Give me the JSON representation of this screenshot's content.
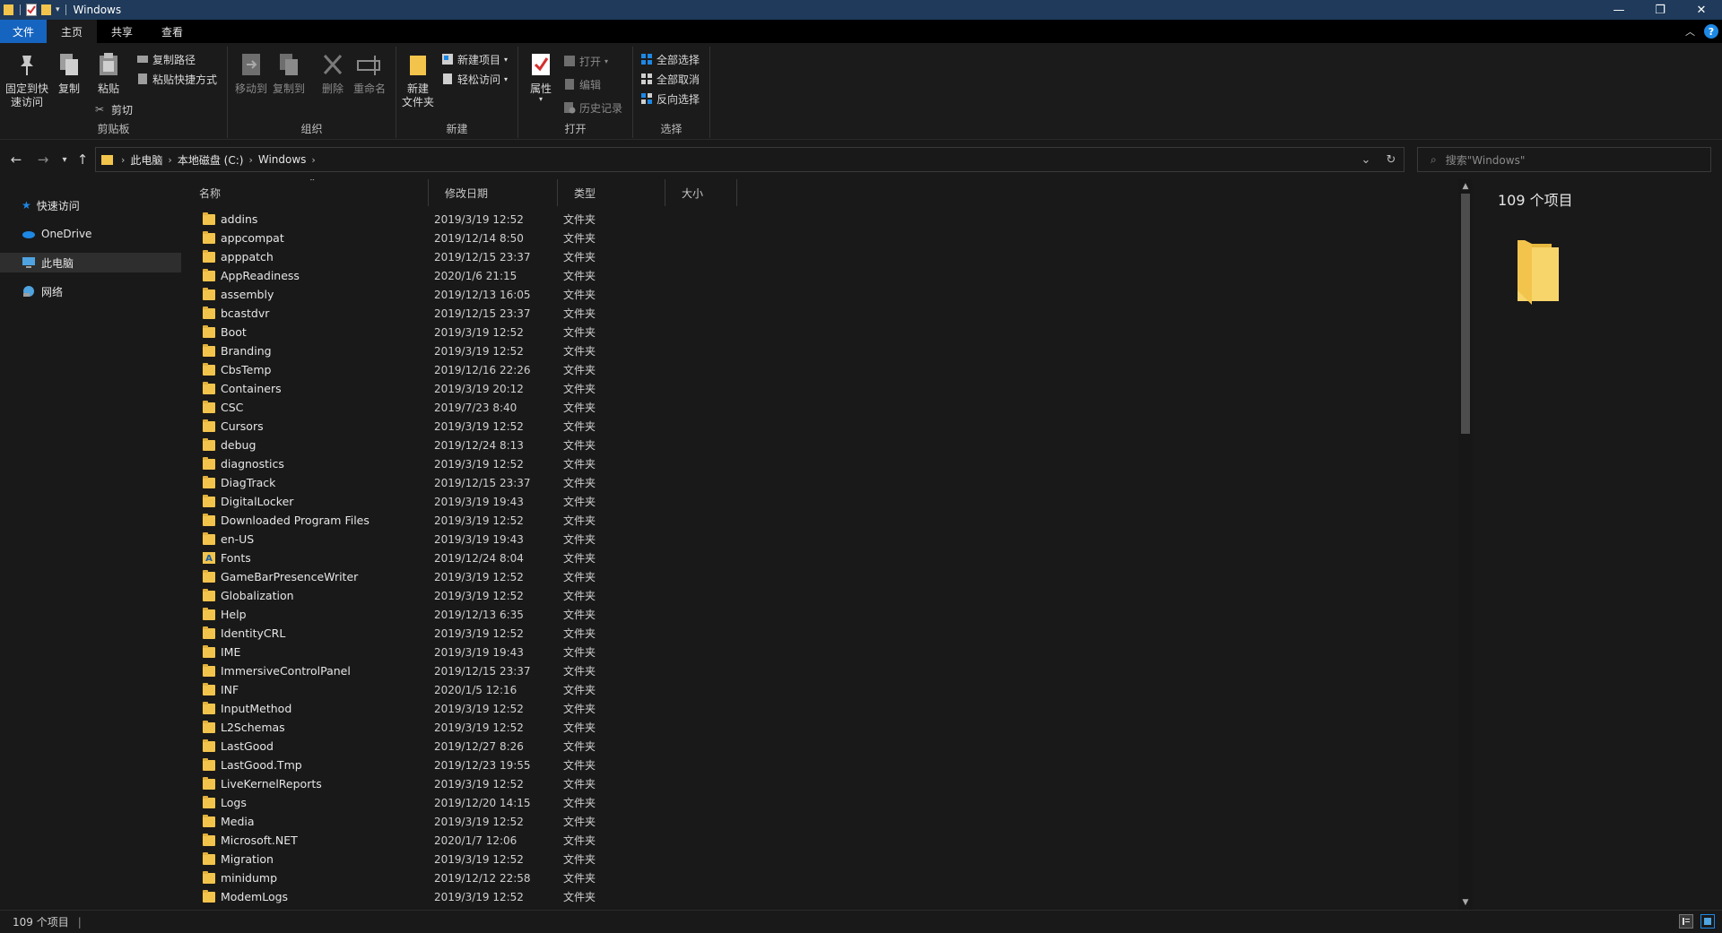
{
  "window": {
    "title": "Windows",
    "minimize": "—",
    "maximize": "❐",
    "close": "✕"
  },
  "ribbon_tabs": [
    {
      "label": "文件"
    },
    {
      "label": "主页"
    },
    {
      "label": "共享"
    },
    {
      "label": "查看"
    }
  ],
  "ribbon": {
    "clipboard": {
      "pin_label_1": "固定到快",
      "pin_label_2": "速访问",
      "copy": "复制",
      "paste": "粘贴",
      "copy_path": "复制路径",
      "paste_shortcut": "粘贴快捷方式",
      "cut": "剪切",
      "group_label": "剪贴板"
    },
    "organize": {
      "move_to": "移动到",
      "copy_to": "复制到",
      "delete": "删除",
      "rename": "重命名",
      "group_label": "组织"
    },
    "new": {
      "new_folder_1": "新建",
      "new_folder_2": "文件夹",
      "new_item": "新建项目",
      "easy_access": "轻松访问",
      "group_label": "新建"
    },
    "open": {
      "properties": "属性",
      "open": "打开",
      "edit": "编辑",
      "history": "历史记录",
      "group_label": "打开"
    },
    "select": {
      "select_all": "全部选择",
      "select_none": "全部取消",
      "invert": "反向选择",
      "group_label": "选择"
    }
  },
  "address": {
    "crumbs": [
      "此电脑",
      "本地磁盘 (C:)",
      "Windows"
    ],
    "search_placeholder": "搜索\"Windows\""
  },
  "nav_pane": [
    {
      "label": "快速访问",
      "icon": "star-icon"
    },
    {
      "label": "OneDrive",
      "icon": "cloud-icon"
    },
    {
      "label": "此电脑",
      "icon": "computer-icon",
      "selected": true
    },
    {
      "label": "网络",
      "icon": "network-icon"
    }
  ],
  "columns": {
    "name": "名称",
    "date": "修改日期",
    "type": "类型",
    "size": "大小"
  },
  "files": [
    {
      "name": "addins",
      "date": "2019/3/19 12:52",
      "type": "文件夹"
    },
    {
      "name": "appcompat",
      "date": "2019/12/14 8:50",
      "type": "文件夹"
    },
    {
      "name": "apppatch",
      "date": "2019/12/15 23:37",
      "type": "文件夹"
    },
    {
      "name": "AppReadiness",
      "date": "2020/1/6 21:15",
      "type": "文件夹"
    },
    {
      "name": "assembly",
      "date": "2019/12/13 16:05",
      "type": "文件夹"
    },
    {
      "name": "bcastdvr",
      "date": "2019/12/15 23:37",
      "type": "文件夹"
    },
    {
      "name": "Boot",
      "date": "2019/3/19 12:52",
      "type": "文件夹"
    },
    {
      "name": "Branding",
      "date": "2019/3/19 12:52",
      "type": "文件夹"
    },
    {
      "name": "CbsTemp",
      "date": "2019/12/16 22:26",
      "type": "文件夹"
    },
    {
      "name": "Containers",
      "date": "2019/3/19 20:12",
      "type": "文件夹"
    },
    {
      "name": "CSC",
      "date": "2019/7/23 8:40",
      "type": "文件夹"
    },
    {
      "name": "Cursors",
      "date": "2019/3/19 12:52",
      "type": "文件夹"
    },
    {
      "name": "debug",
      "date": "2019/12/24 8:13",
      "type": "文件夹"
    },
    {
      "name": "diagnostics",
      "date": "2019/3/19 12:52",
      "type": "文件夹"
    },
    {
      "name": "DiagTrack",
      "date": "2019/12/15 23:37",
      "type": "文件夹"
    },
    {
      "name": "DigitalLocker",
      "date": "2019/3/19 19:43",
      "type": "文件夹"
    },
    {
      "name": "Downloaded Program Files",
      "date": "2019/3/19 12:52",
      "type": "文件夹"
    },
    {
      "name": "en-US",
      "date": "2019/3/19 19:43",
      "type": "文件夹"
    },
    {
      "name": "Fonts",
      "date": "2019/12/24 8:04",
      "type": "文件夹",
      "special": "fonts"
    },
    {
      "name": "GameBarPresenceWriter",
      "date": "2019/3/19 12:52",
      "type": "文件夹"
    },
    {
      "name": "Globalization",
      "date": "2019/3/19 12:52",
      "type": "文件夹"
    },
    {
      "name": "Help",
      "date": "2019/12/13 6:35",
      "type": "文件夹"
    },
    {
      "name": "IdentityCRL",
      "date": "2019/3/19 12:52",
      "type": "文件夹"
    },
    {
      "name": "IME",
      "date": "2019/3/19 19:43",
      "type": "文件夹"
    },
    {
      "name": "ImmersiveControlPanel",
      "date": "2019/12/15 23:37",
      "type": "文件夹"
    },
    {
      "name": "INF",
      "date": "2020/1/5 12:16",
      "type": "文件夹"
    },
    {
      "name": "InputMethod",
      "date": "2019/3/19 12:52",
      "type": "文件夹"
    },
    {
      "name": "L2Schemas",
      "date": "2019/3/19 12:52",
      "type": "文件夹"
    },
    {
      "name": "LastGood",
      "date": "2019/12/27 8:26",
      "type": "文件夹"
    },
    {
      "name": "LastGood.Tmp",
      "date": "2019/12/23 19:55",
      "type": "文件夹"
    },
    {
      "name": "LiveKernelReports",
      "date": "2019/3/19 12:52",
      "type": "文件夹"
    },
    {
      "name": "Logs",
      "date": "2019/12/20 14:15",
      "type": "文件夹"
    },
    {
      "name": "Media",
      "date": "2019/3/19 12:52",
      "type": "文件夹"
    },
    {
      "name": "Microsoft.NET",
      "date": "2020/1/7 12:06",
      "type": "文件夹"
    },
    {
      "name": "Migration",
      "date": "2019/3/19 12:52",
      "type": "文件夹"
    },
    {
      "name": "minidump",
      "date": "2019/12/12 22:58",
      "type": "文件夹"
    },
    {
      "name": "ModemLogs",
      "date": "2019/3/19 12:52",
      "type": "文件夹"
    }
  ],
  "preview": {
    "count_text": "109 个项目"
  },
  "status": {
    "count_text": "109 个项目"
  },
  "colors": {
    "titlebar": "#1f3a5a",
    "file_tab": "#1565c0",
    "folder": "#f2c44c",
    "background": "#191919"
  }
}
